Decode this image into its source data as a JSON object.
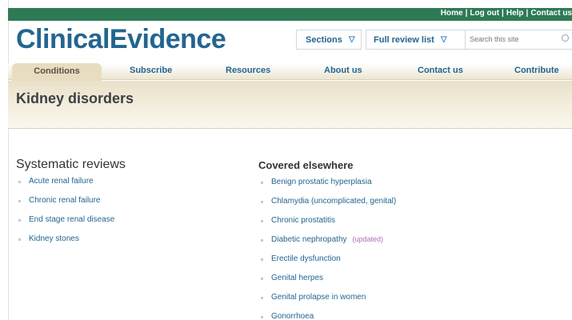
{
  "header": {
    "top_links": [
      "Home",
      "Log out",
      "Help",
      "Contact us"
    ],
    "logo": "ClinicalEvidence",
    "sections_label": "Sections",
    "review_label": "Full review list",
    "search_placeholder": "Search this site"
  },
  "nav": {
    "tabs": [
      "Conditions",
      "Subscribe",
      "Resources",
      "About us",
      "Contact us",
      "Contribute"
    ]
  },
  "page": {
    "title": "Kidney disorders"
  },
  "systematic_reviews": {
    "heading": "Systematic reviews",
    "items": [
      "Acute renal failure",
      "Chronic renal failure",
      "End stage renal disease",
      "Kidney stones"
    ]
  },
  "covered_elsewhere": {
    "heading": "Covered elsewhere",
    "items": [
      "Benign prostatic hyperplasia",
      "Chlamydia (uncomplicated, genital)",
      "Chronic prostatitis",
      "Diabetic nephropathy",
      "Erectile dysfunction",
      "Genital herpes",
      "Genital prolapse in women",
      "Gonorrhoea"
    ],
    "updated_badge": "(updated)"
  }
}
